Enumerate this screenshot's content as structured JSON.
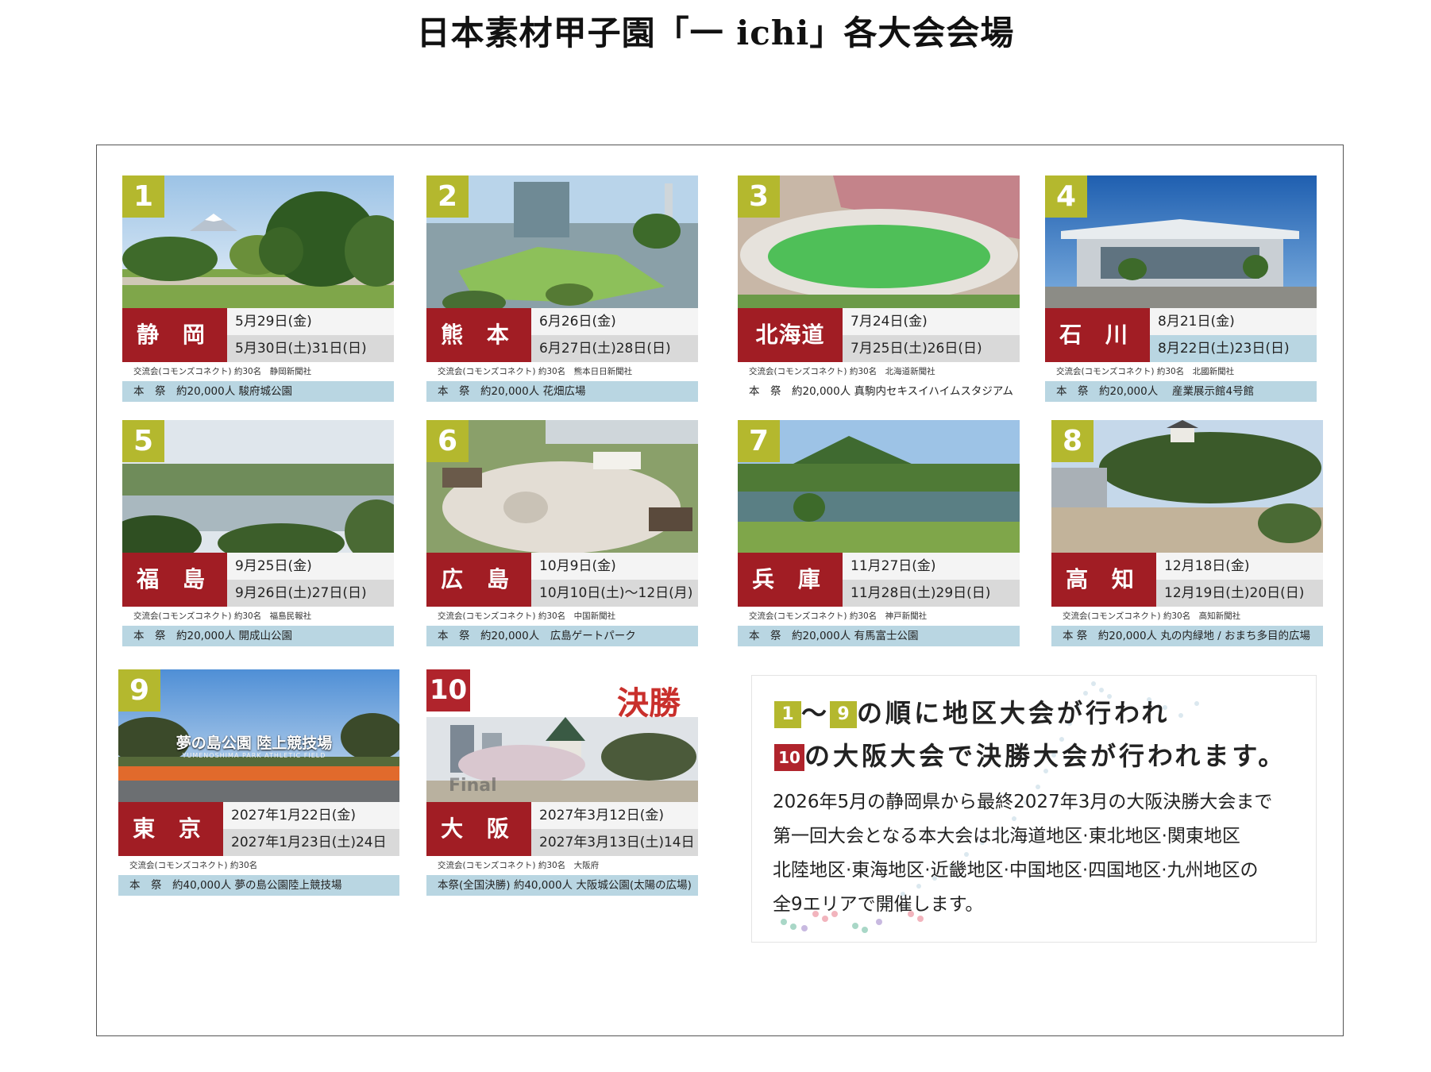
{
  "title": "日本素材甲子園「一 ichi」各大会会場",
  "cards": [
    {
      "num": "1",
      "name": "静 岡",
      "date1": "5月29日(金)",
      "date2": "5月30日(土)31日(日)",
      "exchange": "交流会(コモンズコネクト) 約30名　静岡新聞社",
      "main": "本　祭　約20,000人 駿府城公園"
    },
    {
      "num": "2",
      "name": "熊 本",
      "date1": "6月26日(金)",
      "date2": "6月27日(土)28日(日)",
      "exchange": "交流会(コモンズコネクト) 約30名　熊本日日新聞社",
      "main": "本　祭　約20,000人 花畑広場"
    },
    {
      "num": "3",
      "name": "北海道",
      "date1": "7月24日(金)",
      "date2": "7月25日(土)26日(日)",
      "exchange": "交流会(コモンズコネクト) 約30名　北海道新聞社",
      "main": "本　祭　約20,000人 真駒内セキスイハイムスタジアム"
    },
    {
      "num": "4",
      "name": "石 川",
      "date1": "8月21日(金)",
      "date2": "8月22日(土)23日(日)",
      "exchange": "交流会(コモンズコネクト) 約30名　北國新聞社",
      "main": "本　祭　約20,000人　 産業展示館4号館"
    },
    {
      "num": "5",
      "name": "福 島",
      "date1": "9月25日(金)",
      "date2": "9月26日(土)27日(日)",
      "exchange": "交流会(コモンズコネクト) 約30名　福島民報社",
      "main": "本　祭　約20,000人 開成山公園"
    },
    {
      "num": "6",
      "name": "広 島",
      "date1": "10月9日(金)",
      "date2": "10月10日(土)～12日(月)",
      "exchange": "交流会(コモンズコネクト) 約30名　中国新聞社",
      "main": "本　祭　約20,000人　広島ゲートパーク"
    },
    {
      "num": "7",
      "name": "兵 庫",
      "date1": "11月27日(金)",
      "date2": "11月28日(土)29日(日)",
      "exchange": "交流会(コモンズコネクト) 約30名　神戸新聞社",
      "main": "本　祭　約20,000人 有馬富士公園"
    },
    {
      "num": "8",
      "name": "高 知",
      "date1": "12月18日(金)",
      "date2": "12月19日(土)20日(日)",
      "exchange": "交流会(コモンズコネクト) 約30名　高知新聞社",
      "main": "本 祭　約20,000人 丸の内緑地 / おまち多目的広場"
    },
    {
      "num": "9",
      "name": "東 京",
      "date1": "2027年1月22日(金)",
      "date2": "2027年1月23日(土)24日(日)",
      "exchange": "交流会(コモンズコネクト) 約30名",
      "main": "本　祭　約40,000人 夢の島公園陸上競技場",
      "sign": "夢の島公園 陸上競技場",
      "sign_sub": "YUMENOSHIMA PARK ATHLETIC FIELD"
    },
    {
      "num": "10",
      "name": "大 阪",
      "date1": "2027年3月12日(金)",
      "date2": "2027年3月13日(土)14日(日)",
      "exchange": "交流会(コモンズコネクト) 約30名　大阪府",
      "main": "本祭(全国決勝) 約40,000人 大阪城公園(太陽の広場)",
      "final_label": "決勝",
      "final_ghost": "Final"
    }
  ],
  "info": {
    "chip_start": "1",
    "tilde": "～",
    "chip_end": "9",
    "line1_text": "の順に地区大会が行われ",
    "chip_final": "10",
    "line2_text": "の大阪大会で決勝大会が行われます。",
    "para": [
      "2026年5月の静岡県から最終2027年3月の大阪決勝大会まで",
      "第一回大会となる本大会は北海道地区·東北地区·関東地区",
      "北陸地区·東海地区·近畿地区·中国地区·四国地区·九州地区の",
      "全9エリアで開催します。"
    ]
  },
  "colors": {
    "number_badge": "#b4b82e",
    "final_badge": "#b0242c",
    "name_box": "#a11d24",
    "main_bar": "#b9d6e2"
  }
}
